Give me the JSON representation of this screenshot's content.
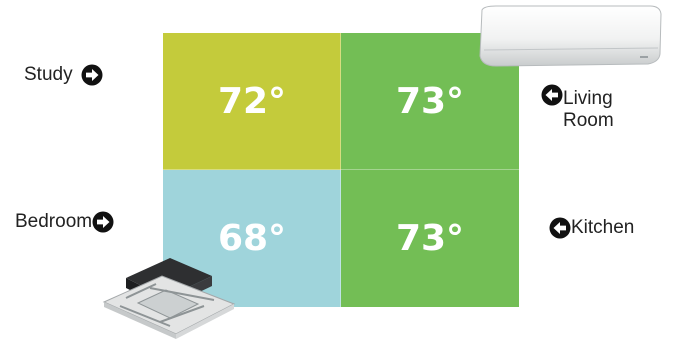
{
  "zones": {
    "study": {
      "temp": "72°",
      "color": "#c4cb3b"
    },
    "living": {
      "temp": "73°",
      "color": "#73be55"
    },
    "bedroom": {
      "temp": "68°",
      "color": "#9fd4db"
    },
    "kitchen": {
      "temp": "73°",
      "color": "#73be55"
    }
  },
  "labels": {
    "study": "Study",
    "bedroom": "Bedroom",
    "living_line1": "Living",
    "living_line2": "Room",
    "kitchen": "Kitchen"
  },
  "icons": {
    "arrow_right": "arrow-right-circle-icon",
    "arrow_left": "arrow-left-circle-icon",
    "wall_unit": "wall-mounted-ac-unit",
    "cassette_unit": "ceiling-cassette-ac-unit"
  }
}
